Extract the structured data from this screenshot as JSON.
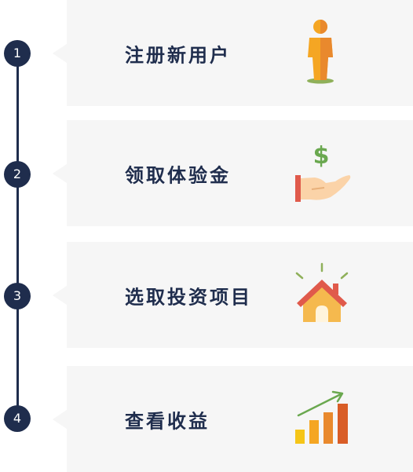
{
  "steps": [
    {
      "number": "1",
      "label": "注册新用户",
      "icon": "person-icon"
    },
    {
      "number": "2",
      "label": "领取体验金",
      "icon": "hand-money-icon"
    },
    {
      "number": "3",
      "label": "选取投资项目",
      "icon": "house-icon"
    },
    {
      "number": "4",
      "label": "查看收益",
      "icon": "growth-chart-icon"
    }
  ],
  "icon_symbols": {
    "dollar": "$"
  },
  "colors": {
    "timeline": "#1f2d4d",
    "card_bg": "#f6f6f6",
    "text": "#1f2d4d",
    "orange": "#f5a623",
    "dark_orange": "#e9892d",
    "red": "#e05a4b",
    "green": "#6aa84f"
  }
}
